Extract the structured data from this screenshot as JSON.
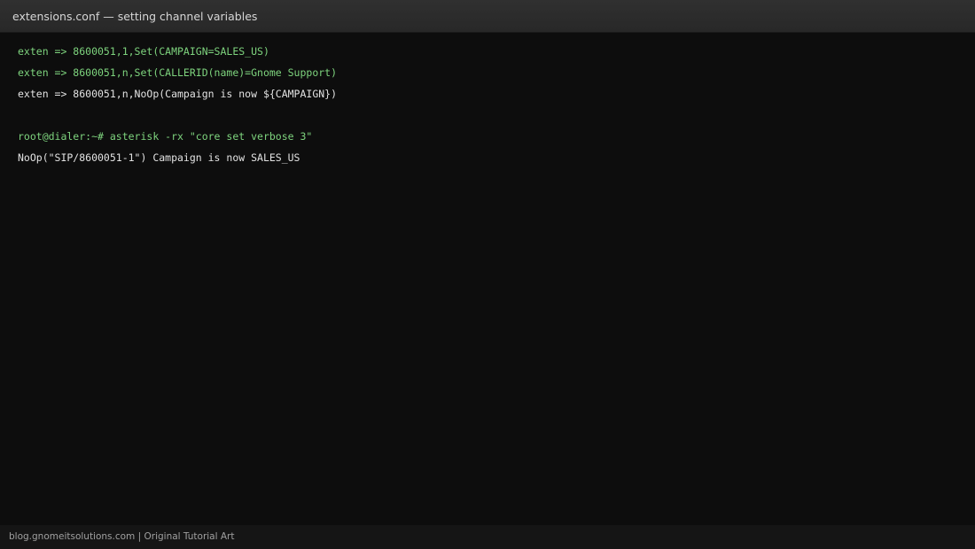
{
  "window": {
    "title": "extensions.conf — setting channel variables"
  },
  "terminal": {
    "lines": [
      {
        "text": "exten => 8600051,1,Set(CAMPAIGN=SALES_US)",
        "color": "#7ed47e"
      },
      {
        "text": "exten => 8600051,n,Set(CALLERID(name)=Gnome Support)",
        "color": "#7ed47e"
      },
      {
        "text": "exten => 8600051,n,NoOp(Campaign is now ${CAMPAIGN})",
        "color": "#e2e2e2"
      },
      {
        "text": "root@dialer:~# asterisk -rx \"core set verbose 3\"",
        "color": "#7ed47e"
      },
      {
        "text": "NoOp(\"SIP/8600051-1\") Campaign is now SALES_US",
        "color": "#e2e2e2"
      }
    ]
  },
  "footer": {
    "credit": "blog.gnomeitsolutions.com | Original Tutorial Art"
  },
  "colors": {
    "background": "#0d0d0d",
    "titlebar": "#2c2c2c",
    "accent_green": "#7ed47e"
  }
}
